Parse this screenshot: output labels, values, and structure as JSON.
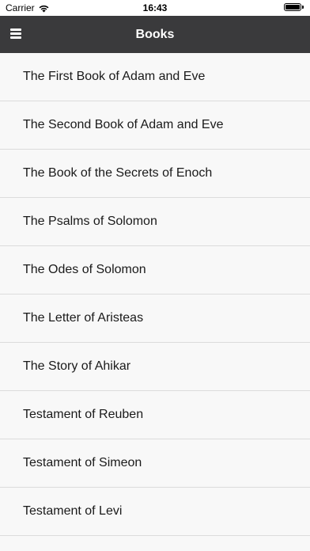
{
  "status_bar": {
    "carrier": "Carrier",
    "time": "16:43",
    "wifi_icon": "wifi-icon",
    "battery_level": 1.0
  },
  "nav_bar": {
    "title": "Books",
    "menu_icon": "hamburger-menu-icon",
    "background": "#3a3a3c"
  },
  "books": [
    {
      "title": "The First Book of Adam and Eve"
    },
    {
      "title": "The Second Book of Adam and Eve"
    },
    {
      "title": "The Book of the Secrets of Enoch"
    },
    {
      "title": "The Psalms of Solomon"
    },
    {
      "title": "The Odes of Solomon"
    },
    {
      "title": "The Letter of Aristeas"
    },
    {
      "title": "The Story of Ahikar"
    },
    {
      "title": "Testament of Reuben"
    },
    {
      "title": "Testament of Simeon"
    },
    {
      "title": "Testament of Levi"
    }
  ]
}
